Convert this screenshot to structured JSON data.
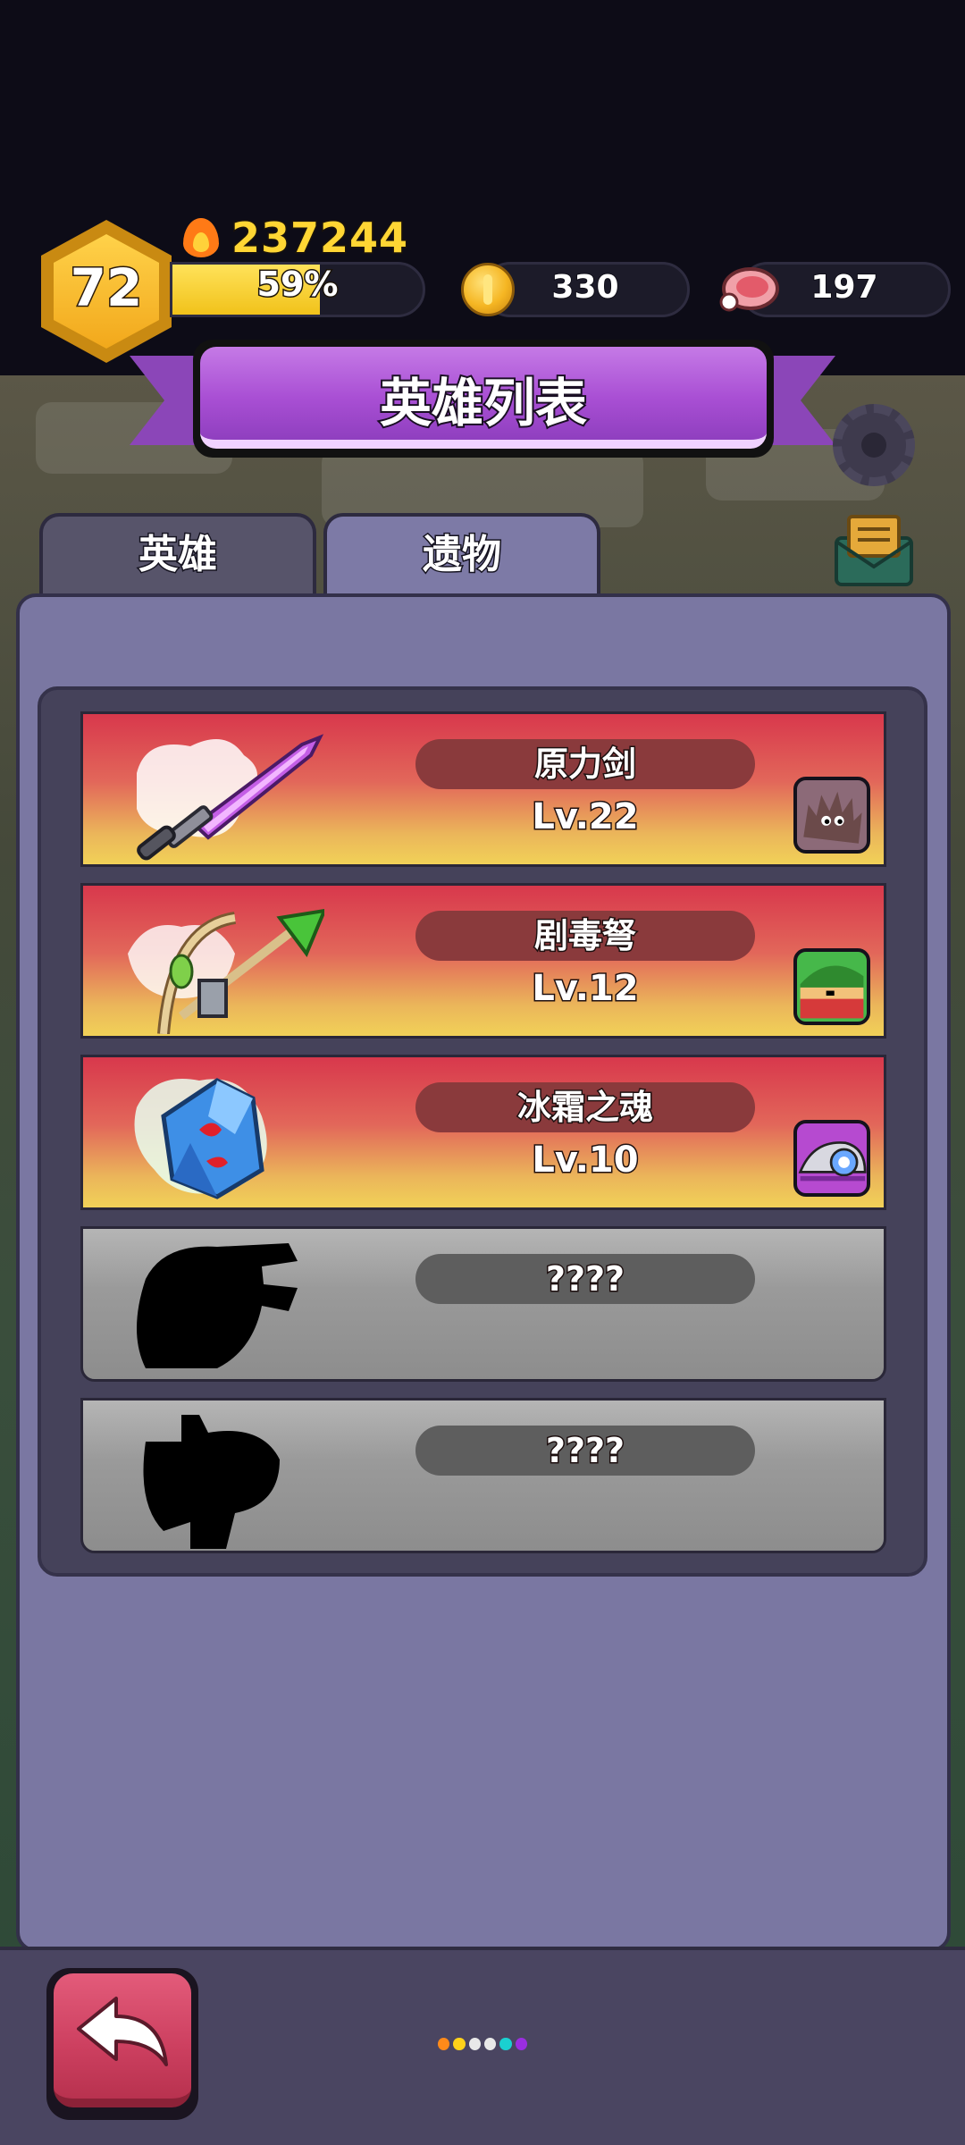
{
  "header": {
    "player_level": "72",
    "power": "237244",
    "xp_percent_text": "59%",
    "xp_fraction": 0.59,
    "coins": "330",
    "meat": "197"
  },
  "title": "英雄列表",
  "tabs": [
    {
      "label": "英雄",
      "active": false
    },
    {
      "label": "遗物",
      "active": true
    }
  ],
  "relics": [
    {
      "name": "原力剑",
      "level": "Lv.22",
      "locked": false,
      "art_icon": "purple-sword-icon",
      "hero_icon": "furry-monster-portrait"
    },
    {
      "name": "剧毒弩",
      "level": "Lv.12",
      "locked": false,
      "art_icon": "crossbow-icon",
      "hero_icon": "green-hood-portrait"
    },
    {
      "name": "冰霜之魂",
      "level": "Lv.10",
      "locked": false,
      "art_icon": "ice-crystal-icon",
      "hero_icon": "robot-portrait"
    },
    {
      "name": "????",
      "level": "",
      "locked": true,
      "art_icon": "locked-silhouette-icon"
    },
    {
      "name": "????",
      "level": "",
      "locked": true,
      "art_icon": "locked-silhouette-icon"
    }
  ],
  "colors": {
    "accent_purple": "#a94fd4",
    "gold": "#ffd634",
    "card_red": "#d8384c",
    "panel": "#7a77a2"
  },
  "page_dots": [
    "#ff8a1a",
    "#ffd21a",
    "#e8e8e8",
    "#e8e8e8",
    "#1ad0d0",
    "#9a2ee0"
  ]
}
